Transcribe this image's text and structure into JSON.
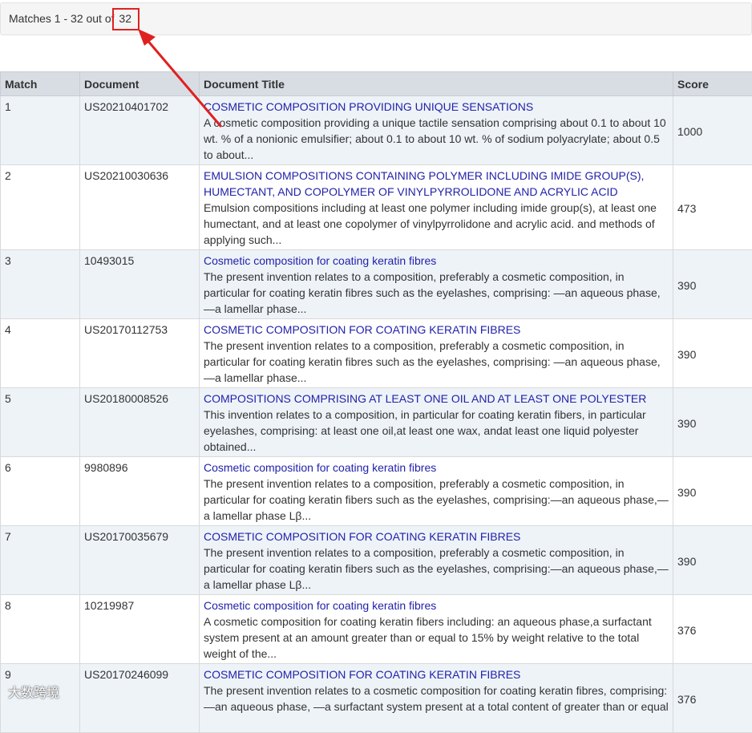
{
  "summary": {
    "prefix": "Matches 1 - 32 out of ",
    "total": "32"
  },
  "table": {
    "headers": {
      "match": "Match",
      "document": "Document",
      "title": "Document Title",
      "score": "Score"
    },
    "rows": [
      {
        "match": "1",
        "document": "US20210401702",
        "title": "COSMETIC COMPOSITION PROVIDING UNIQUE SENSATIONS",
        "abstract": "A cosmetic composition providing a unique tactile sensation comprising about 0.1 to about 10 wt. % of a nonionic emulsifier; about 0.1 to about 10 wt. % of sodium polyacrylate; about 0.5 to about...",
        "score": "1000"
      },
      {
        "match": "2",
        "document": "US20210030636",
        "title": "EMULSION COMPOSITIONS CONTAINING POLYMER INCLUDING IMIDE GROUP(S), HUMECTANT, AND COPOLYMER OF VINYLPYRROLIDONE AND ACRYLIC ACID",
        "abstract": "Emulsion compositions including at least one polymer including imide group(s), at least one humectant, and at least one copolymer of vinylpyrrolidone and acrylic acid. and methods of applying such...",
        "score": "473"
      },
      {
        "match": "3",
        "document": "10493015",
        "title": "Cosmetic composition for coating keratin fibres",
        "abstract": "The present invention relates to a composition, preferably a cosmetic composition, in particular for coating keratin fibres such as the eyelashes, comprising: —an aqueous phase, —a lamellar phase...",
        "score": "390"
      },
      {
        "match": "4",
        "document": "US20170112753",
        "title": "COSMETIC COMPOSITION FOR COATING KERATIN FIBRES",
        "abstract": "The present invention relates to a composition, preferably a cosmetic composition, in particular for coating keratin fibres such as the eyelashes, comprising: —an aqueous phase, —a lamellar phase...",
        "score": "390"
      },
      {
        "match": "5",
        "document": "US20180008526",
        "title": "COMPOSITIONS COMPRISING AT LEAST ONE OIL AND AT LEAST ONE POLYESTER",
        "abstract": "This invention relates to a composition, in particular for coating keratin fibers, in particular eyelashes, comprising: at least one oil,at least one wax, andat least one liquid polyester obtained...",
        "score": "390"
      },
      {
        "match": "6",
        "document": "9980896",
        "title": "Cosmetic composition for coating keratin fibres",
        "abstract": "The present invention relates to a composition, preferably a cosmetic composition, in particular for coating keratin fibers such as the eyelashes, comprising:—an aqueous phase,—a lamellar phase Lβ...",
        "score": "390"
      },
      {
        "match": "7",
        "document": "US20170035679",
        "title": "COSMETIC COMPOSITION FOR COATING KERATIN FIBRES",
        "abstract": "The present invention relates to a composition, preferably a cosmetic composition, in particular for coating keratin fibers such as the eyelashes, comprising:—an aqueous phase,—a lamellar phase Lβ...",
        "score": "390"
      },
      {
        "match": "8",
        "document": "10219987",
        "title": "Cosmetic composition for coating keratin fibres",
        "abstract": "A cosmetic composition for coating keratin fibers including: an aqueous phase,a surfactant system present at an amount greater than or equal to 15% by weight relative to the total weight of the...",
        "score": "376"
      },
      {
        "match": "9",
        "document": "US20170246099",
        "title": "COSMETIC COMPOSITION FOR COATING KERATIN FIBRES",
        "abstract": "The present invention relates to a cosmetic composition for coating keratin fibres, comprising: —an aqueous phase, —a surfactant system present at a total content of greater than or equal",
        "score": "376"
      }
    ]
  },
  "watermark": "大数跨境",
  "annotation_color": "#e02020"
}
